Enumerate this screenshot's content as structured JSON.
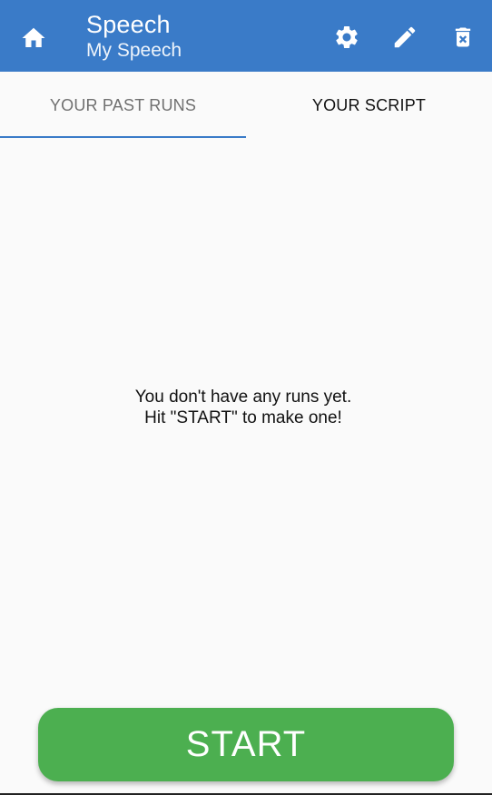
{
  "appbar": {
    "title": "Speech",
    "subtitle": "My Speech",
    "icons": {
      "home": "home-icon",
      "settings": "gear-icon",
      "edit": "pencil-icon",
      "delete": "trash-icon"
    }
  },
  "tabs": [
    {
      "label": "YOUR PAST RUNS",
      "selected": true
    },
    {
      "label": "YOUR SCRIPT",
      "selected": false
    }
  ],
  "empty_state": {
    "line1": "You don't have any runs yet.",
    "line2": "Hit \"START\" to make one!"
  },
  "start_button": {
    "label": "START"
  },
  "colors": {
    "appbar": "#3a7bc8",
    "start": "#4caf50",
    "background": "#fafafa"
  }
}
